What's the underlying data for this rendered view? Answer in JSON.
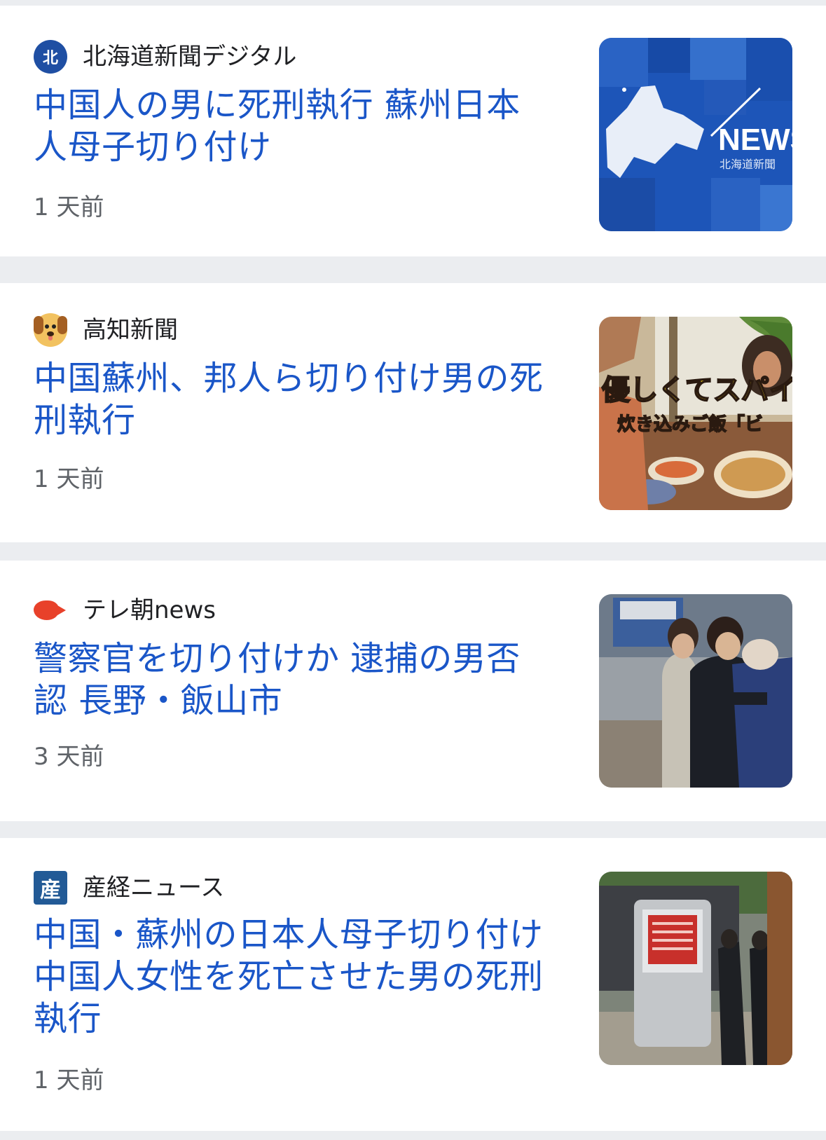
{
  "articles": [
    {
      "source": "北海道新聞デジタル",
      "logo_icon": "hokkaido-shimbun-logo",
      "logo_text": "北",
      "headline": "中国人の男に死刑執行 蘇州日本人母子切り付け",
      "time": "1 天前",
      "thumb_text": "NEWS",
      "thumb_subtext": "北海道新聞"
    },
    {
      "source": "高知新聞",
      "logo_icon": "kochi-shimbun-dog-logo",
      "headline": "中国蘇州、邦人ら切り付け男の死刑執行",
      "time": "1 天前",
      "thumb_text": "優しくてスパイ",
      "thumb_subtext": "炊き込みご飯「ビ"
    },
    {
      "source": "テレ朝news",
      "logo_icon": "tv-asahi-logo",
      "headline": "警察官を切り付けか 逮捕の男否認 長野・飯山市",
      "time": "3 天前"
    },
    {
      "source": "産経ニュース",
      "logo_icon": "sankei-logo",
      "logo_text": "産",
      "headline": "中国・蘇州の日本人母子切り付け 中国人女性を死亡させた男の死刑執行",
      "time": "1 天前"
    }
  ],
  "colors": {
    "headline": "#1a56c8",
    "source": "#202124",
    "time": "#5f6368",
    "divider": "#ebedf0",
    "card": "#ffffff"
  }
}
